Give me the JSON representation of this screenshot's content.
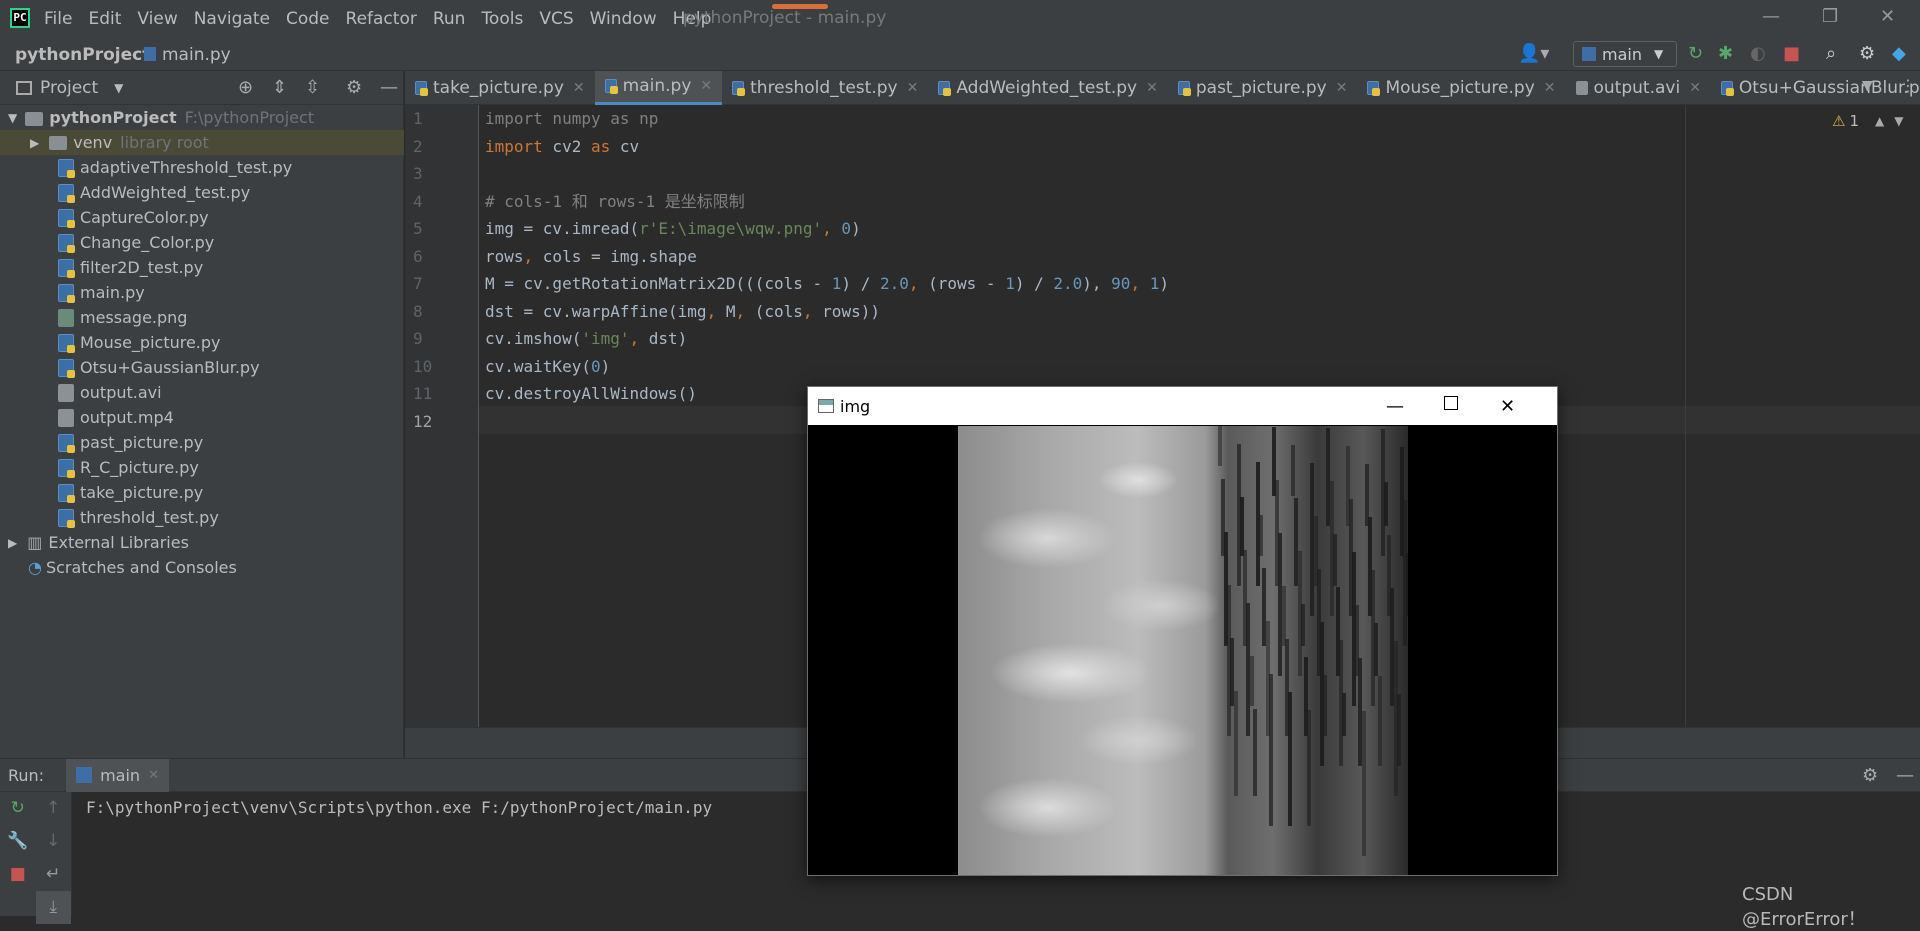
{
  "app": {
    "logo": "PC",
    "menu": [
      "File",
      "Edit",
      "View",
      "Navigate",
      "Code",
      "Refactor",
      "Run",
      "Tools",
      "VCS",
      "Window",
      "Help"
    ],
    "window_title": "pythonProject - main.py"
  },
  "navbar": {
    "project": "pythonProject",
    "file": "main.py",
    "branch": "main"
  },
  "project_panel": {
    "title": "Project",
    "root_name": "pythonProject",
    "root_path": "F:\\pythonProject",
    "venv_name": "venv",
    "venv_hint": "library root",
    "files": [
      {
        "name": "adaptiveThreshold_test.py",
        "type": "py"
      },
      {
        "name": "AddWeighted_test.py",
        "type": "py"
      },
      {
        "name": "CaptureColor.py",
        "type": "py"
      },
      {
        "name": "Change_Color.py",
        "type": "py"
      },
      {
        "name": "filter2D_test.py",
        "type": "py"
      },
      {
        "name": "main.py",
        "type": "py"
      },
      {
        "name": "message.png",
        "type": "img"
      },
      {
        "name": "Mouse_picture.py",
        "type": "py"
      },
      {
        "name": "Otsu+GaussianBlur.py",
        "type": "py"
      },
      {
        "name": "output.avi",
        "type": "doc"
      },
      {
        "name": "output.mp4",
        "type": "doc"
      },
      {
        "name": "past_picture.py",
        "type": "py"
      },
      {
        "name": "R_C_picture.py",
        "type": "py"
      },
      {
        "name": "take_picture.py",
        "type": "py"
      },
      {
        "name": "threshold_test.py",
        "type": "py"
      }
    ],
    "external_libraries": "External Libraries",
    "scratches": "Scratches and Consoles"
  },
  "tabs": [
    {
      "label": "take_picture.py",
      "active": false
    },
    {
      "label": "main.py",
      "active": true
    },
    {
      "label": "threshold_test.py",
      "active": false
    },
    {
      "label": "AddWeighted_test.py",
      "active": false
    },
    {
      "label": "past_picture.py",
      "active": false
    },
    {
      "label": "Mouse_picture.py",
      "active": false
    },
    {
      "label": "output.avi",
      "active": false
    },
    {
      "label": "Otsu+GaussianBlur.py",
      "active": false
    }
  ],
  "editor": {
    "warnings": "1",
    "line_numbers": [
      "1",
      "2",
      "3",
      "4",
      "5",
      "6",
      "7",
      "8",
      "9",
      "10",
      "11",
      "12"
    ],
    "code": {
      "l1a": "import",
      "l1b": " numpy ",
      "l1c": "as",
      "l1d": " np",
      "l2a": "import",
      "l2b": " cv2 ",
      "l2c": "as",
      "l2d": " cv",
      "l4": "# cols-1 和 rows-1 是坐标限制",
      "l5a": "img = cv.imread(",
      "l5b": "r'E:\\image\\wqw.png'",
      "l5c": ", ",
      "l5d": "0",
      "l5e": ")",
      "l6a": "rows",
      "l6b": ", ",
      "l6c": "cols = img.shape",
      "l7a": "M = cv.getRotationMatrix2D(((cols - ",
      "l7b": "1",
      "l7c": ") / ",
      "l7d": "2.0",
      "l7e": ", ",
      "l7f": "(rows - ",
      "l7g": "1",
      "l7h": ") / ",
      "l7i": "2.0",
      "l7j": "), ",
      "l7k": "90",
      "l7l": ", ",
      "l7m": "1",
      "l7n": ")",
      "l8a": "dst = cv.warpAffine(img",
      "l8b": ", ",
      "l8c": "M",
      "l8d": ", ",
      "l8e": "(cols",
      "l8f": ", ",
      "l8g": "rows))",
      "l9a": "cv.imshow(",
      "l9b": "'img'",
      "l9c": ", ",
      "l9d": "dst)",
      "l10a": "cv.waitKey(",
      "l10b": "0",
      "l10c": ")",
      "l11": "cv.destroyAllWindows()"
    }
  },
  "run": {
    "label": "Run:",
    "tab": "main",
    "output": "F:\\pythonProject\\venv\\Scripts\\python.exe F:/pythonProject/main.py"
  },
  "popup": {
    "title": "img"
  },
  "watermark": "CSDN @ErrorError！"
}
